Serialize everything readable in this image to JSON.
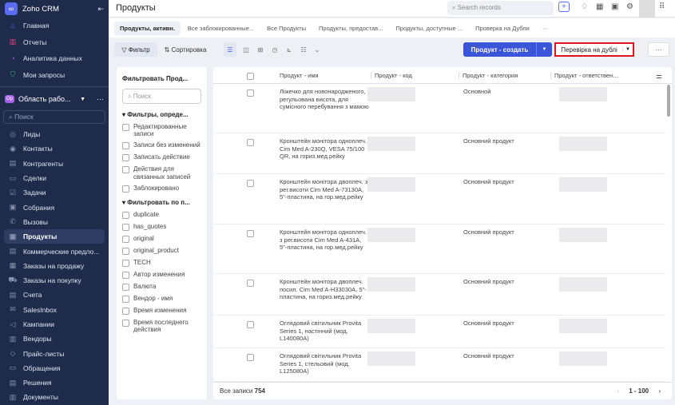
{
  "sidebar": {
    "app_name": "Zoho CRM",
    "top_items": [
      {
        "label": "Главная",
        "icon": "home-icon"
      },
      {
        "label": "Отчеты",
        "icon": "reports-icon"
      },
      {
        "label": "Аналитика данных",
        "icon": "analytics-icon"
      },
      {
        "label": "Мои запросы",
        "icon": "requests-icon"
      }
    ],
    "workspace": {
      "badge": "Op",
      "label": "Область рабо..."
    },
    "search_placeholder": "Поиск",
    "items": [
      {
        "label": "Лиды"
      },
      {
        "label": "Контакты"
      },
      {
        "label": "Контрагенты"
      },
      {
        "label": "Сделки"
      },
      {
        "label": "Задачи"
      },
      {
        "label": "Собрания"
      },
      {
        "label": "Вызовы"
      },
      {
        "label": "Продукты",
        "active": true
      },
      {
        "label": "Коммерческие предло..."
      },
      {
        "label": "Заказы на продажу"
      },
      {
        "label": "Заказы на покупку"
      },
      {
        "label": "Счета"
      },
      {
        "label": "SalesInbox"
      },
      {
        "label": "Кампании"
      },
      {
        "label": "Вендоры"
      },
      {
        "label": "Прайс-листы"
      },
      {
        "label": "Обращения"
      },
      {
        "label": "Решения"
      },
      {
        "label": "Документы"
      }
    ]
  },
  "header": {
    "title": "Продукты",
    "search_placeholder": "Search records"
  },
  "tabs": [
    {
      "label": "Продукты, активн.",
      "active": true
    },
    {
      "label": "Все заблокированные..."
    },
    {
      "label": "Все Продукты"
    },
    {
      "label": "Продукты, предостав..."
    },
    {
      "label": "Продукты, доступные ..."
    },
    {
      "label": "Проверка на Дубли"
    },
    {
      "label": "···"
    }
  ],
  "toolbar": {
    "filter": "Фильтр",
    "sort": "Сортировка",
    "create": "Продукт - создать",
    "dedupe": "Перевірка на дублі",
    "more": "···"
  },
  "filters": {
    "title": "Фильтровать Прод...",
    "search_placeholder": "Поиск",
    "section1": "Фильтры, опреде...",
    "items1": [
      "Редактированные записи",
      "Записи без изменений",
      "Записать действие",
      "Действия для связанных записей",
      "Заблокировано"
    ],
    "section2": "Фильтровать по п...",
    "items2": [
      "duplicate",
      "has_quotes",
      "original",
      "original_product",
      "TECH",
      "Автор изменения",
      "Валюта",
      "Вендор - имя",
      "Время изменения",
      "Время последнего действия"
    ]
  },
  "table": {
    "columns": [
      "Продукт - имя",
      "Продукт - код",
      "Продукт - категория",
      "Продукт - ответствен..."
    ],
    "rows": [
      {
        "name": "Ліжечко для новонародженого, регульована висота, для сумісного перебування з мамою",
        "category": "Основной"
      },
      {
        "name": "Кронштейн монітора одноплеч. Cim Med A-230Q, VESA 75/100 QR, на гориз.мед.рейку",
        "category": "Основний продукт"
      },
      {
        "name": "Кронштейн монітора двоплеч. з рег.висоти Cim Med A-73130A, 5\"-пластина, на гор.мед.рейку",
        "category": "Основний продукт"
      },
      {
        "name": "Кронштейн монітора одноплеч. з рег.висоти Cim Med A-431A, 5\"-пластина, на гор.мед.рейку",
        "category": "Основний продукт"
      },
      {
        "name": "Кронштейн монітора двоплеч. посил. Cim Med A-H33030A, 5\"-пластина, на гориз.мед.рейку",
        "category": "Основний продукт"
      },
      {
        "name": "Оглядовий світильник Provita Series 1, настінний (мод. L140080A)",
        "category": "Основний продукт"
      },
      {
        "name": "Оглядовий світильник Provita Series 1, стельовий (мод. L125080A)",
        "category": "Основний продукт"
      }
    ],
    "total_label": "Все записи",
    "total": "754",
    "page_range": "1 - 100"
  }
}
